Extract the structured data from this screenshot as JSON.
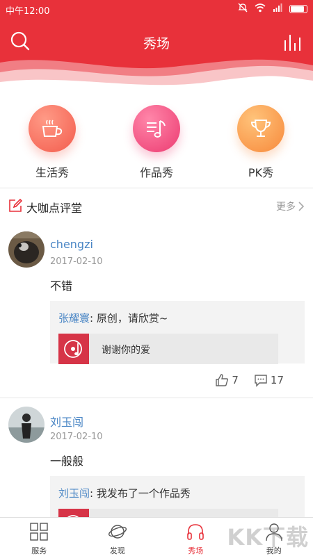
{
  "status": {
    "time": "中午12:00"
  },
  "header": {
    "title": "秀场"
  },
  "categories": [
    {
      "label": "生活秀",
      "icon": "coffee-cup-icon"
    },
    {
      "label": "作品秀",
      "icon": "music-list-icon"
    },
    {
      "label": "PK秀",
      "icon": "trophy-icon"
    }
  ],
  "section": {
    "title": "大咖点评堂",
    "more": "更多"
  },
  "posts": [
    {
      "username": "chengzi",
      "date": "2017-02-10",
      "text": "不错",
      "quote_user": "张耀寰",
      "quote_text": ": 原创，请欣赏~",
      "attachment": "谢谢你的爱",
      "likes": "7",
      "comments": "17"
    },
    {
      "username": "刘玉闯",
      "date": "2017-02-10",
      "text": "一般般",
      "quote_user": "刘玉闯",
      "quote_text": ": 我发布了一个作品秀"
    }
  ],
  "nav": [
    {
      "label": "服务",
      "icon": "grid-icon"
    },
    {
      "label": "发现",
      "icon": "planet-icon"
    },
    {
      "label": "秀场",
      "icon": "headphones-icon"
    },
    {
      "label": "我的",
      "icon": "person-icon"
    }
  ],
  "watermark": "KK下载",
  "colors": {
    "primary": "#e8313a",
    "link": "#4a86c5"
  }
}
